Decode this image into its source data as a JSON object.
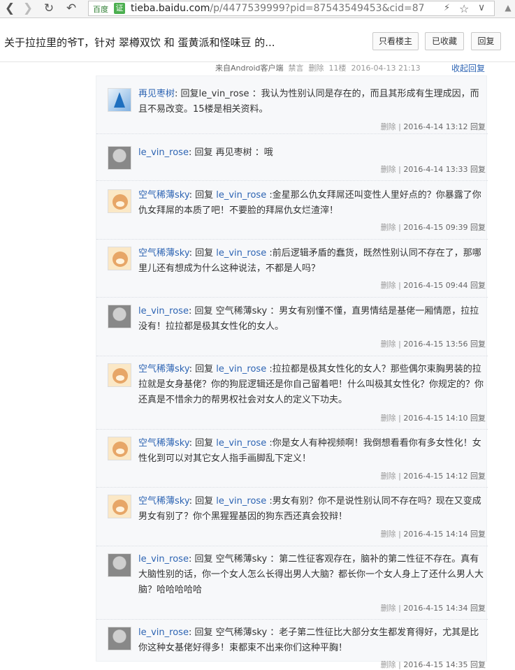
{
  "browser": {
    "site_badge": "百度",
    "cert_label": "证",
    "url_host": "tieba.baidu.com",
    "url_path": "/p/4477539999?pid=87543549453&cid=87"
  },
  "thread": {
    "title": "关于拉拉里的爷T，针对 翠樽双饮 和 蛋黄派和怪味豆 的...",
    "buttons": {
      "only_op": "只看楼主",
      "favorited": "已收藏",
      "reply": "回复"
    }
  },
  "floor": {
    "source": "来自Android客户端",
    "ban": "禁言",
    "delete": "删除",
    "floor_no": "11楼",
    "time": "2016-04-13 21:13",
    "collapse": "收起回复"
  },
  "replies": [
    {
      "user": "再见枣树",
      "prefix": ": 回复",
      "target": "le_vin_rose",
      "body": " ：我认为性别认同是存在的，而且其形成有生理成因，而且不易改变。15楼是相关资料。",
      "delete": "删除",
      "sep": "|",
      "time": "2016-4-14 13:12",
      "reply": "回复",
      "avatar": "blue"
    },
    {
      "user": "le_vin_rose",
      "prefix": ": 回复",
      "target": "",
      "body": " 再见枣树 ：哦",
      "delete": "删除",
      "sep": "|",
      "time": "2016-4-14 13:33",
      "reply": "回复",
      "avatar": "gray"
    },
    {
      "user": "空气稀薄sky",
      "prefix": ": 回复 ",
      "target": "le_vin_rose",
      "body": " :金星那么仇女拜屌还叫变性人里好点的？你暴露了你仇女拜屌的本质了吧！不要脸的拜屌仇女烂渣滓！",
      "delete": "删除",
      "sep": "|",
      "time": "2016-4-15 09:39",
      "reply": "回复",
      "avatar": "bear"
    },
    {
      "user": "空气稀薄sky",
      "prefix": ": 回复 ",
      "target": "le_vin_rose",
      "body": " :前后逻辑矛盾的蠢货，既然性别认同不存在了，那哪里儿还有想成为什么这种说法，不都是人吗？",
      "delete": "删除",
      "sep": "|",
      "time": "2016-4-15 09:44",
      "reply": "回复",
      "avatar": "bear"
    },
    {
      "user": "le_vin_rose",
      "prefix": ": 回复",
      "target": "",
      "body": " 空气稀薄sky ：男女有别懂不懂，直男情结是基佬一厢情愿，拉拉没有！拉拉都是极其女性化的女人。",
      "delete": "删除",
      "sep": "|",
      "time": "2016-4-15 13:56",
      "reply": "回复",
      "avatar": "gray"
    },
    {
      "user": "空气稀薄sky",
      "prefix": ": 回复 ",
      "target": "le_vin_rose",
      "body": " :拉拉都是极其女性化的女人？那些偶尔束胸男装的拉拉就是女身基佬？你的狗屁逻辑还是你自己留着吧！什么叫极其女性化？你规定的？你还真是不惜余力的帮男权社会对女人的定义下功夫。",
      "delete": "删除",
      "sep": "|",
      "time": "2016-4-15 14:10",
      "reply": "回复",
      "avatar": "bear"
    },
    {
      "user": "空气稀薄sky",
      "prefix": ": 回复 ",
      "target": "le_vin_rose",
      "body": " :你是女人有种视频啊！我倒想看看你有多女性化！女性化到可以对其它女人指手画脚乱下定义！",
      "delete": "删除",
      "sep": "|",
      "time": "2016-4-15 14:12",
      "reply": "回复",
      "avatar": "bear"
    },
    {
      "user": "空气稀薄sky",
      "prefix": ": 回复 ",
      "target": "le_vin_rose",
      "body": " :男女有别？你不是说性别认同不存在吗？现在又变成男女有别了？你个黑猩猩基因的狗东西还真会狡辩！",
      "delete": "删除",
      "sep": "|",
      "time": "2016-4-15 14:14",
      "reply": "回复",
      "avatar": "bear"
    },
    {
      "user": "le_vin_rose",
      "prefix": ": 回复",
      "target": "",
      "body": " 空气稀薄sky ：第二性征客观存在，脑补的第二性征不存在。真有大脑性别的话，你一个女人怎么长得出男人大脑？都长你一个女人身上了还什么男人大脑？哈哈哈哈哈",
      "delete": "删除",
      "sep": "|",
      "time": "2016-4-15 14:34",
      "reply": "回复",
      "avatar": "gray"
    },
    {
      "user": "le_vin_rose",
      "prefix": ": 回复",
      "target": "",
      "body": " 空气稀薄sky ：老子第二性征比大部分女生都发育得好，尤其是比你这种女基佬好得多！束都束不出来你们这种平胸！",
      "delete": "删除",
      "sep": "|",
      "time": "2016-4-15 14:35",
      "reply": "回复",
      "avatar": "gray"
    }
  ]
}
